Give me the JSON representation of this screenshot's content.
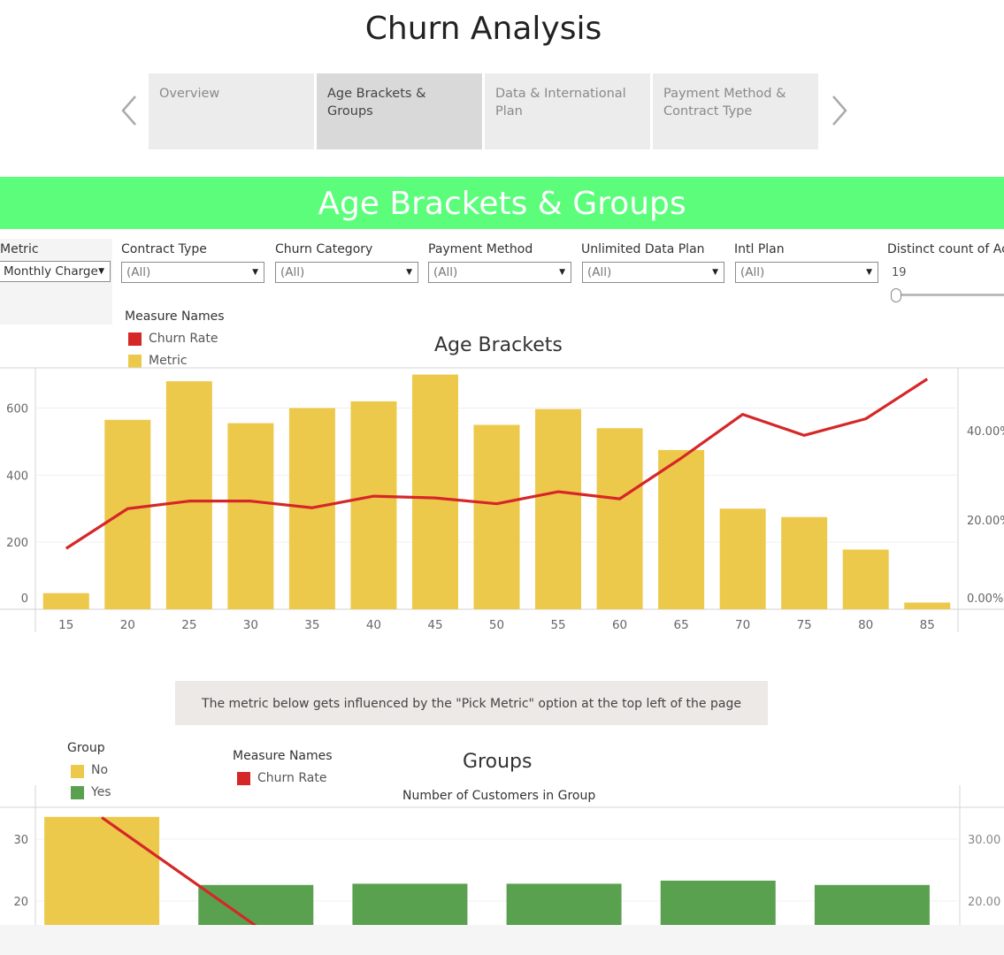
{
  "page_title": "Churn Analysis",
  "nav": {
    "prev_icon": "chevron-left-icon",
    "next_icon": "chevron-right-icon",
    "tabs": [
      {
        "label": "Overview",
        "active": false
      },
      {
        "label": "Age Brackets & Groups",
        "active": true
      },
      {
        "label": "Data & International Plan",
        "active": false
      },
      {
        "label": "Payment Method & Contract Type",
        "active": false
      }
    ]
  },
  "banner": {
    "title": "Age Brackets & Groups",
    "color": "#5bfd7b"
  },
  "filters": {
    "metric": {
      "label": "Metric",
      "value": "Monthly Charge"
    },
    "contract_type": {
      "label": "Contract Type",
      "value": "(All)"
    },
    "churn_category": {
      "label": "Churn Category",
      "value": "(All)"
    },
    "payment_method": {
      "label": "Payment Method",
      "value": "(All)"
    },
    "unlimited_data_plan": {
      "label": "Unlimited Data Plan",
      "value": "(All)"
    },
    "intl_plan": {
      "label": "Intl Plan",
      "value": "(All)"
    },
    "distinct_count": {
      "label": "Distinct count of Ac",
      "value": "19"
    }
  },
  "age_legend": {
    "title": "Measure Names",
    "items": [
      {
        "label": "Churn Rate",
        "color": "#d62728"
      },
      {
        "label": "Metric",
        "color": "#ecc94b"
      }
    ]
  },
  "note": "The metric below gets influenced by the \"Pick Metric\" option at the top left of the page",
  "group_legend": {
    "title": "Group",
    "items": [
      {
        "label": "No",
        "color": "#ecc94b"
      },
      {
        "label": "Yes",
        "color": "#59a14f"
      }
    ]
  },
  "groups_measure_legend": {
    "title": "Measure Names",
    "items": [
      {
        "label": "Churn Rate",
        "color": "#d62728"
      }
    ]
  },
  "chart_data": [
    {
      "type": "bar",
      "title": "Age Brackets",
      "categories": [
        "15",
        "20",
        "25",
        "30",
        "35",
        "40",
        "45",
        "50",
        "55",
        "60",
        "65",
        "70",
        "75",
        "80",
        "85"
      ],
      "series": [
        {
          "name": "Metric",
          "axis": "left",
          "color": "#ecc94b",
          "values": [
            48,
            565,
            680,
            555,
            600,
            620,
            700,
            550,
            597,
            540,
            475,
            300,
            275,
            178,
            20
          ]
        },
        {
          "name": "Churn Rate",
          "axis": "right",
          "type": "line",
          "color": "#d62728",
          "values": [
            13.6,
            22.5,
            24.2,
            24.2,
            22.7,
            25.3,
            24.9,
            23.6,
            26.3,
            24.7,
            33.8,
            43.6,
            38.9,
            42.6,
            51.5
          ]
        }
      ],
      "y_left": {
        "ticks": [
          "0",
          "200",
          "400",
          "600"
        ],
        "range": [
          0,
          720
        ]
      },
      "y_right": {
        "ticks": [
          "0.00%",
          "20.00%",
          "40.00%"
        ],
        "range": [
          0,
          54
        ]
      },
      "grid": true
    },
    {
      "type": "bar",
      "title": "Groups",
      "xlabel": "Number of Customers in Group",
      "categories": [
        "",
        "",
        "",
        "",
        "",
        ""
      ],
      "series": [
        {
          "name": "No",
          "color": "#ecc94b",
          "values": [
            33.6,
            null,
            null,
            null,
            null,
            null
          ]
        },
        {
          "name": "Yes",
          "color": "#59a14f",
          "values": [
            null,
            22.6,
            22.8,
            22.8,
            23.3,
            22.6
          ]
        },
        {
          "name": "Churn Rate",
          "axis": "right",
          "type": "line",
          "color": "#d62728",
          "values": [
            33.5,
            16.0,
            null,
            null,
            null,
            null
          ]
        }
      ],
      "y_left": {
        "ticks": [
          "20",
          "30"
        ],
        "range": [
          16,
          35
        ]
      },
      "y_right": {
        "ticks": [
          "20.00",
          "30.00"
        ]
      },
      "grid": true
    }
  ]
}
